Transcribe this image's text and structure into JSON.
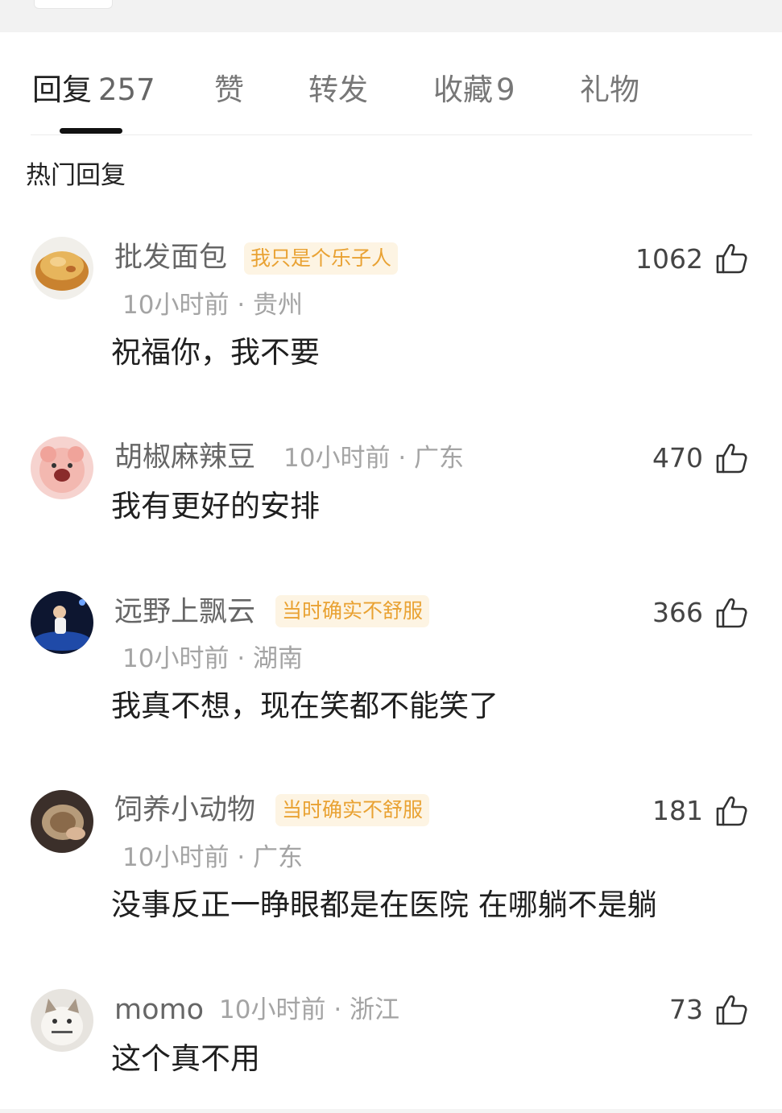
{
  "tabs": [
    {
      "label": "回复",
      "count": "257"
    },
    {
      "label": "赞",
      "count": ""
    },
    {
      "label": "转发",
      "count": ""
    },
    {
      "label": "收藏",
      "count": "9"
    },
    {
      "label": "礼物",
      "count": ""
    }
  ],
  "section_title": "热门回复",
  "comments": [
    {
      "nickname": "批发面包",
      "badge": "我只是个乐子人",
      "time": "10小时前",
      "location": "贵州",
      "separator": "·",
      "text": "祝福你，我不要",
      "likes": "1062"
    },
    {
      "nickname": "胡椒麻辣豆",
      "badge": "",
      "time": "10小时前",
      "location": "广东",
      "separator": "·",
      "text": "我有更好的安排",
      "likes": "470"
    },
    {
      "nickname": "远野上飘云",
      "badge": "当时确实不舒服",
      "time": "10小时前",
      "location": "湖南",
      "separator": "·",
      "text": "我真不想，现在笑都不能笑了",
      "likes": "366"
    },
    {
      "nickname": "饲养小动物",
      "badge": "当时确实不舒服",
      "time": "10小时前",
      "location": "广东",
      "separator": "·",
      "text": "没事反正一睁眼都是在医院 在哪躺不是躺",
      "likes": "181"
    },
    {
      "nickname": "momo",
      "badge": "",
      "time": "10小时前",
      "location": "浙江",
      "separator": "·",
      "text": "这个真不用",
      "likes": "73"
    }
  ],
  "colors": {
    "badge_bg": "#fdf4e3",
    "badge_text": "#e9a233",
    "active_tab": "#222222",
    "inactive_tab": "#777777",
    "meta": "#a4a4a4"
  },
  "icons": {
    "like": "thumbs-up-icon"
  }
}
